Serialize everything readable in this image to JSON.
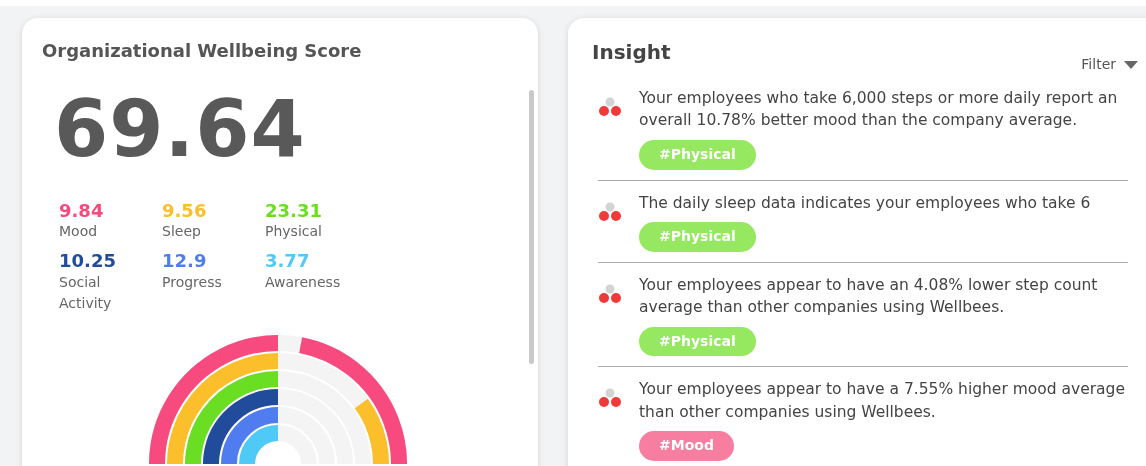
{
  "score_card": {
    "title": "Organizational Wellbeing Score",
    "score": "69.64",
    "metrics": [
      {
        "value": "9.84",
        "label": "Mood",
        "color": "#f74a7e"
      },
      {
        "value": "9.56",
        "label": "Sleep",
        "color": "#fbbf2c"
      },
      {
        "value": "23.31",
        "label": "Physical",
        "color": "#6ade23"
      },
      {
        "value": "10.25",
        "label": "Social Activity",
        "color": "#214c9c"
      },
      {
        "value": "12.9",
        "label": "Progress",
        "color": "#4f7df0"
      },
      {
        "value": "3.77",
        "label": "Awareness",
        "color": "#4fc9f5"
      }
    ]
  },
  "insight_card": {
    "title": "Insight",
    "filter": "Filter",
    "items": [
      {
        "text": "Your employees who take 6,000 steps or more daily report an overall 10.78% better mood than the company average.",
        "tag": "#Physical",
        "color": "#95e85f"
      },
      {
        "text": "The daily sleep data indicates your employees who take 6",
        "tag": "#Physical",
        "color": "#95e85f"
      },
      {
        "text": "Your employees appear to have an 4.08% lower step count average than other companies using Wellbees.",
        "tag": "#Physical",
        "color": "#95e85f"
      },
      {
        "text": "Your employees appear to have a 7.55% higher mood average than other companies using Wellbees.",
        "tag": "#Mood",
        "color": "#f77ea0"
      }
    ]
  }
}
